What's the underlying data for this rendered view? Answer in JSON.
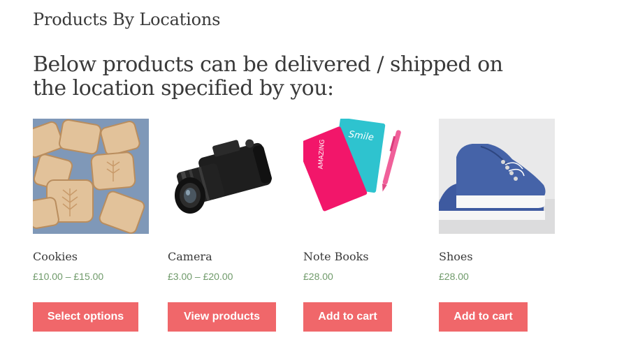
{
  "page": {
    "title": "Products By Locations",
    "intro": "Below products can be delivered / shipped on the location specified by you:"
  },
  "products": [
    {
      "name": "Cookies",
      "price": "£10.00 – £15.00",
      "button": "Select options",
      "image_icon": "cookies-image"
    },
    {
      "name": "Camera",
      "price": "£3.00 – £20.00",
      "button": "View products",
      "image_icon": "camera-image"
    },
    {
      "name": "Note Books",
      "price": "£28.00",
      "button": "Add to cart",
      "image_icon": "notebooks-image",
      "notebook_text_1": "AMAZING",
      "notebook_text_2": "Smile"
    },
    {
      "name": "Shoes",
      "price": "£28.00",
      "button": "Add to cart",
      "image_icon": "shoes-image"
    }
  ],
  "colors": {
    "button_bg": "#f0676a",
    "price": "#6f9a6a",
    "text": "#3a3a3a"
  }
}
